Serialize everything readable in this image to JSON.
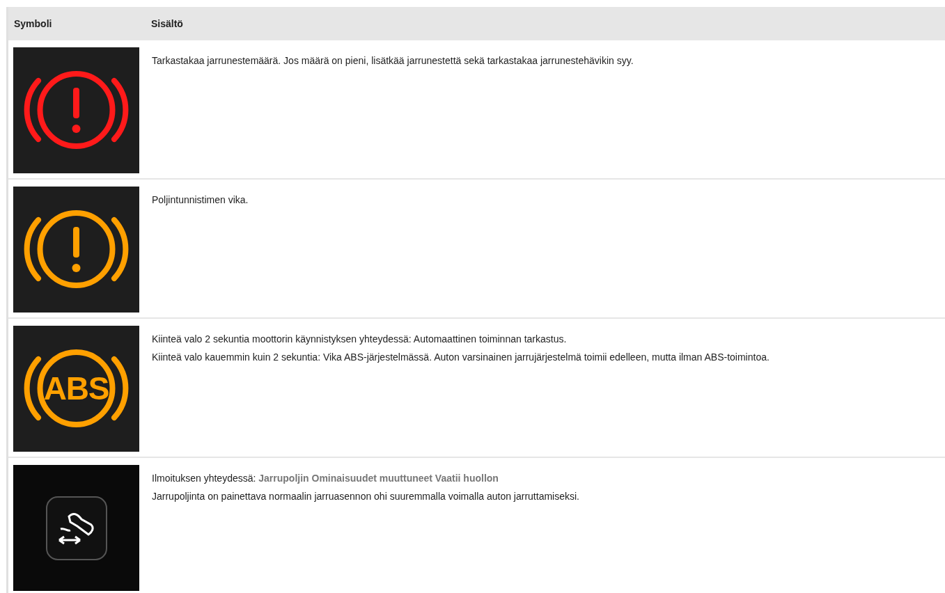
{
  "table": {
    "columns": [
      "Symboli",
      "Sisältö"
    ],
    "rows": [
      {
        "symbol": {
          "kind": "warning",
          "color": "#ff1a1a"
        },
        "lines": [
          "Tarkastakaa jarrunestemäärä. Jos määrä on pieni, lisätkää jarrunestettä sekä tarkastakaa jarrunestehävikin syy."
        ]
      },
      {
        "symbol": {
          "kind": "warning",
          "color": "#ffa000"
        },
        "lines": [
          "Poljintunnistimen vika."
        ]
      },
      {
        "symbol": {
          "kind": "abs",
          "color": "#ffa000",
          "text": "ABS"
        },
        "lines": [
          "Kiinteä valo 2 sekuntia moottorin käynnistyksen yhteydessä: Automaattinen toiminnan tarkastus.",
          "Kiinteä valo kauemmin kuin 2 sekuntia: Vika ABS-järjestelmässä. Auton varsinainen jarrujärjestelmä toimii edelleen, mutta ilman ABS-toimintoa."
        ]
      },
      {
        "symbol": {
          "kind": "pedal"
        },
        "lines": [
          "Ilmoituksen yhteydessä: **Jarrupoljin Ominaisuudet muuttuneet Vaatii huollon**",
          "Jarrupoljinta on painettava normaalin jarruasennon ohi suuremmalla voimalla auton jarruttamiseksi."
        ]
      }
    ]
  }
}
